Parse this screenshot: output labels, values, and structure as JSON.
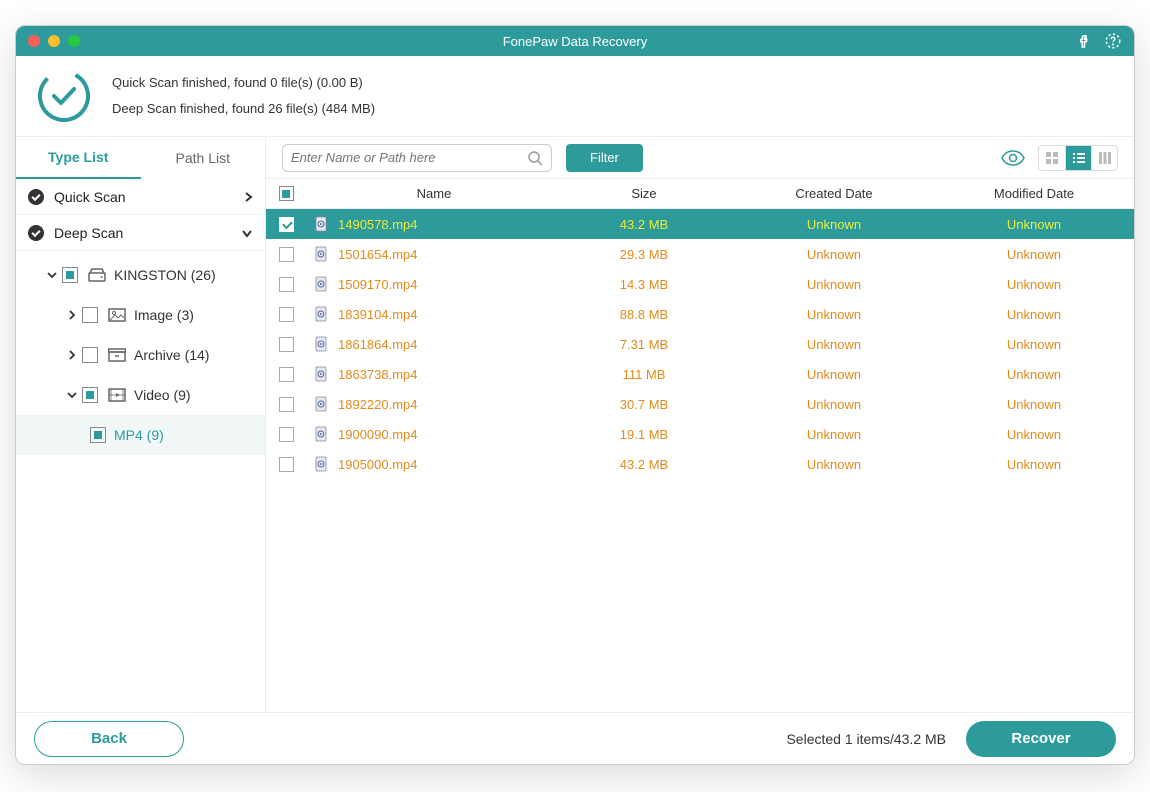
{
  "titlebar": {
    "title": "FonePaw Data Recovery"
  },
  "header": {
    "quick_scan_status": "Quick Scan finished, found 0 file(s) (0.00  B)",
    "deep_scan_status": "Deep Scan finished, found 26 file(s) (484 MB)"
  },
  "tabs": {
    "type_list": "Type List",
    "path_list": "Path List"
  },
  "left": {
    "quick_scan": "Quick Scan",
    "deep_scan": "Deep Scan",
    "device": "KINGSTON (26)",
    "image": "Image  (3)",
    "archive": "Archive  (14)",
    "video": "Video  (9)",
    "mp4": "MP4  (9)"
  },
  "toolbar": {
    "search_placeholder": "Enter Name or Path here",
    "filter": "Filter"
  },
  "columns": {
    "name": "Name",
    "size": "Size",
    "created": "Created Date",
    "modified": "Modified Date"
  },
  "files": [
    {
      "name": "1490578.mp4",
      "size": "43.2 MB",
      "created": "Unknown",
      "modified": "Unknown",
      "checked": true,
      "selected": true
    },
    {
      "name": "1501654.mp4",
      "size": "29.3 MB",
      "created": "Unknown",
      "modified": "Unknown",
      "checked": false,
      "selected": false
    },
    {
      "name": "1509170.mp4",
      "size": "14.3 MB",
      "created": "Unknown",
      "modified": "Unknown",
      "checked": false,
      "selected": false
    },
    {
      "name": "1839104.mp4",
      "size": "88.8 MB",
      "created": "Unknown",
      "modified": "Unknown",
      "checked": false,
      "selected": false
    },
    {
      "name": "1861864.mp4",
      "size": "7.31 MB",
      "created": "Unknown",
      "modified": "Unknown",
      "checked": false,
      "selected": false
    },
    {
      "name": "1863738.mp4",
      "size": "111 MB",
      "created": "Unknown",
      "modified": "Unknown",
      "checked": false,
      "selected": false
    },
    {
      "name": "1892220.mp4",
      "size": "30.7 MB",
      "created": "Unknown",
      "modified": "Unknown",
      "checked": false,
      "selected": false
    },
    {
      "name": "1900090.mp4",
      "size": "19.1 MB",
      "created": "Unknown",
      "modified": "Unknown",
      "checked": false,
      "selected": false
    },
    {
      "name": "1905000.mp4",
      "size": "43.2 MB",
      "created": "Unknown",
      "modified": "Unknown",
      "checked": false,
      "selected": false
    }
  ],
  "footer": {
    "back": "Back",
    "selected": "Selected 1 items/43.2 MB",
    "recover": "Recover"
  }
}
